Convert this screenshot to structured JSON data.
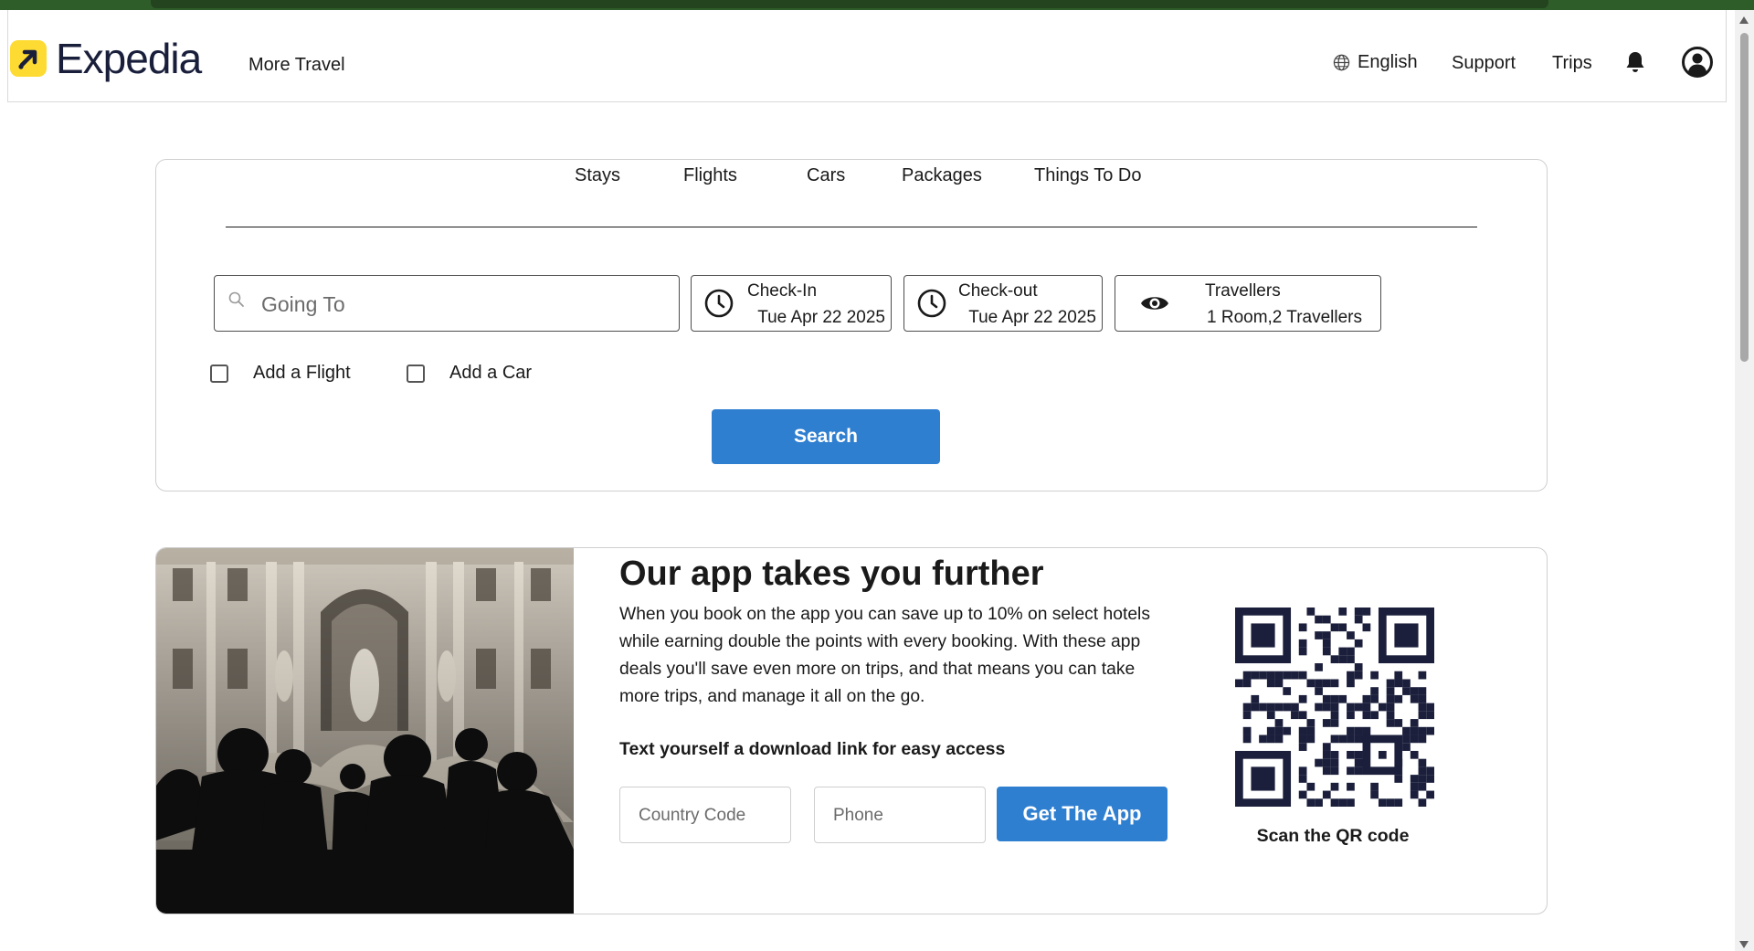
{
  "header": {
    "logo_text": "Expedia",
    "more_travel": "More Travel",
    "language": "English",
    "support": "Support",
    "trips": "Trips",
    "icons": [
      "globe-icon",
      "bell-icon",
      "account-icon"
    ],
    "brand_color": "#fddb32"
  },
  "search": {
    "tabs": [
      "Stays",
      "Flights",
      "Cars",
      "Packages",
      "Things To Do"
    ],
    "going_to_placeholder": "Going To",
    "checkin": {
      "label": "Check-In",
      "value": "Tue Apr 22 2025"
    },
    "checkout": {
      "label": "Check-out",
      "value": "Tue Apr 22 2025"
    },
    "travellers": {
      "label": "Travellers",
      "value": "1 Room,2 Travellers"
    },
    "add_flight": "Add a Flight",
    "add_car": "Add a Car",
    "search_button": "Search",
    "accent_color": "#2f7fd0"
  },
  "promo": {
    "title": "Our app takes you further",
    "body": "When you book on the app you can save up to 10% on select hotels while earning double the points with every booking. With these app deals you'll save even more on trips, and that means you can take more trips, and manage it all on the go.",
    "subtitle": "Text yourself a download link for easy access",
    "country_code_placeholder": "Country Code",
    "phone_placeholder": "Phone",
    "get_app_button": "Get The App",
    "qr_caption": "Scan the QR code"
  }
}
